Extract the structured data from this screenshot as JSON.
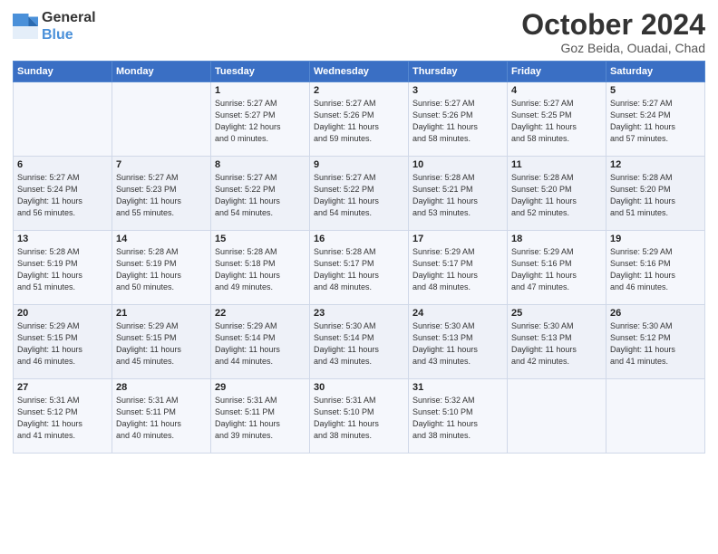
{
  "logo": {
    "line1": "General",
    "line2": "Blue"
  },
  "title": "October 2024",
  "subtitle": "Goz Beida, Ouadai, Chad",
  "weekdays": [
    "Sunday",
    "Monday",
    "Tuesday",
    "Wednesday",
    "Thursday",
    "Friday",
    "Saturday"
  ],
  "weeks": [
    [
      {
        "day": "",
        "info": ""
      },
      {
        "day": "",
        "info": ""
      },
      {
        "day": "1",
        "info": "Sunrise: 5:27 AM\nSunset: 5:27 PM\nDaylight: 12 hours\nand 0 minutes."
      },
      {
        "day": "2",
        "info": "Sunrise: 5:27 AM\nSunset: 5:26 PM\nDaylight: 11 hours\nand 59 minutes."
      },
      {
        "day": "3",
        "info": "Sunrise: 5:27 AM\nSunset: 5:26 PM\nDaylight: 11 hours\nand 58 minutes."
      },
      {
        "day": "4",
        "info": "Sunrise: 5:27 AM\nSunset: 5:25 PM\nDaylight: 11 hours\nand 58 minutes."
      },
      {
        "day": "5",
        "info": "Sunrise: 5:27 AM\nSunset: 5:24 PM\nDaylight: 11 hours\nand 57 minutes."
      }
    ],
    [
      {
        "day": "6",
        "info": "Sunrise: 5:27 AM\nSunset: 5:24 PM\nDaylight: 11 hours\nand 56 minutes."
      },
      {
        "day": "7",
        "info": "Sunrise: 5:27 AM\nSunset: 5:23 PM\nDaylight: 11 hours\nand 55 minutes."
      },
      {
        "day": "8",
        "info": "Sunrise: 5:27 AM\nSunset: 5:22 PM\nDaylight: 11 hours\nand 54 minutes."
      },
      {
        "day": "9",
        "info": "Sunrise: 5:27 AM\nSunset: 5:22 PM\nDaylight: 11 hours\nand 54 minutes."
      },
      {
        "day": "10",
        "info": "Sunrise: 5:28 AM\nSunset: 5:21 PM\nDaylight: 11 hours\nand 53 minutes."
      },
      {
        "day": "11",
        "info": "Sunrise: 5:28 AM\nSunset: 5:20 PM\nDaylight: 11 hours\nand 52 minutes."
      },
      {
        "day": "12",
        "info": "Sunrise: 5:28 AM\nSunset: 5:20 PM\nDaylight: 11 hours\nand 51 minutes."
      }
    ],
    [
      {
        "day": "13",
        "info": "Sunrise: 5:28 AM\nSunset: 5:19 PM\nDaylight: 11 hours\nand 51 minutes."
      },
      {
        "day": "14",
        "info": "Sunrise: 5:28 AM\nSunset: 5:19 PM\nDaylight: 11 hours\nand 50 minutes."
      },
      {
        "day": "15",
        "info": "Sunrise: 5:28 AM\nSunset: 5:18 PM\nDaylight: 11 hours\nand 49 minutes."
      },
      {
        "day": "16",
        "info": "Sunrise: 5:28 AM\nSunset: 5:17 PM\nDaylight: 11 hours\nand 48 minutes."
      },
      {
        "day": "17",
        "info": "Sunrise: 5:29 AM\nSunset: 5:17 PM\nDaylight: 11 hours\nand 48 minutes."
      },
      {
        "day": "18",
        "info": "Sunrise: 5:29 AM\nSunset: 5:16 PM\nDaylight: 11 hours\nand 47 minutes."
      },
      {
        "day": "19",
        "info": "Sunrise: 5:29 AM\nSunset: 5:16 PM\nDaylight: 11 hours\nand 46 minutes."
      }
    ],
    [
      {
        "day": "20",
        "info": "Sunrise: 5:29 AM\nSunset: 5:15 PM\nDaylight: 11 hours\nand 46 minutes."
      },
      {
        "day": "21",
        "info": "Sunrise: 5:29 AM\nSunset: 5:15 PM\nDaylight: 11 hours\nand 45 minutes."
      },
      {
        "day": "22",
        "info": "Sunrise: 5:29 AM\nSunset: 5:14 PM\nDaylight: 11 hours\nand 44 minutes."
      },
      {
        "day": "23",
        "info": "Sunrise: 5:30 AM\nSunset: 5:14 PM\nDaylight: 11 hours\nand 43 minutes."
      },
      {
        "day": "24",
        "info": "Sunrise: 5:30 AM\nSunset: 5:13 PM\nDaylight: 11 hours\nand 43 minutes."
      },
      {
        "day": "25",
        "info": "Sunrise: 5:30 AM\nSunset: 5:13 PM\nDaylight: 11 hours\nand 42 minutes."
      },
      {
        "day": "26",
        "info": "Sunrise: 5:30 AM\nSunset: 5:12 PM\nDaylight: 11 hours\nand 41 minutes."
      }
    ],
    [
      {
        "day": "27",
        "info": "Sunrise: 5:31 AM\nSunset: 5:12 PM\nDaylight: 11 hours\nand 41 minutes."
      },
      {
        "day": "28",
        "info": "Sunrise: 5:31 AM\nSunset: 5:11 PM\nDaylight: 11 hours\nand 40 minutes."
      },
      {
        "day": "29",
        "info": "Sunrise: 5:31 AM\nSunset: 5:11 PM\nDaylight: 11 hours\nand 39 minutes."
      },
      {
        "day": "30",
        "info": "Sunrise: 5:31 AM\nSunset: 5:10 PM\nDaylight: 11 hours\nand 38 minutes."
      },
      {
        "day": "31",
        "info": "Sunrise: 5:32 AM\nSunset: 5:10 PM\nDaylight: 11 hours\nand 38 minutes."
      },
      {
        "day": "",
        "info": ""
      },
      {
        "day": "",
        "info": ""
      }
    ]
  ]
}
